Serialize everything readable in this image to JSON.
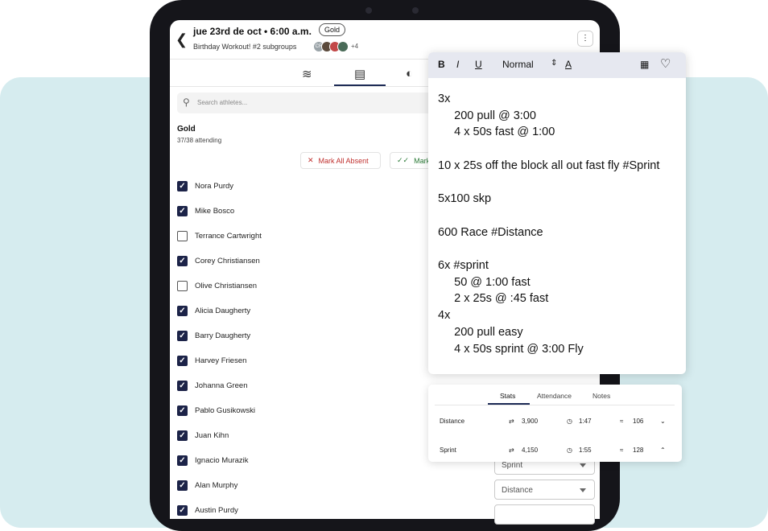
{
  "header": {
    "title": "jue 23rd de oct • 6:00 a.m.",
    "group_badge": "Gold",
    "subtitle": "Birthday Workout!  #2 subgroups",
    "avatar_more": "+4",
    "avatar_initials": "CR"
  },
  "search": {
    "placeholder": "Search athletes..."
  },
  "group": {
    "name": "Gold",
    "attendance": "37/38 attending"
  },
  "actions": {
    "mark_absent": "Mark All Absent",
    "mark_present": "Mark"
  },
  "athletes": [
    {
      "name": "Nora Purdy",
      "present": true
    },
    {
      "name": "Mike Bosco",
      "present": true
    },
    {
      "name": "Terrance Cartwright",
      "present": false
    },
    {
      "name": "Corey Christiansen",
      "present": true
    },
    {
      "name": "Olive Christiansen",
      "present": false
    },
    {
      "name": "Alicia Daugherty",
      "present": true
    },
    {
      "name": "Barry Daugherty",
      "present": true
    },
    {
      "name": "Harvey Friesen",
      "present": true
    },
    {
      "name": "Johanna Green",
      "present": true
    },
    {
      "name": "Pablo Gusikowski",
      "present": true
    },
    {
      "name": "Juan Kihn",
      "present": true
    },
    {
      "name": "Ignacio Murazik",
      "present": true
    },
    {
      "name": "Alan Murphy",
      "present": true
    },
    {
      "name": "Austin Purdy",
      "present": true
    }
  ],
  "selects": {
    "s1": "Sprint",
    "s2": "Distance"
  },
  "editor": {
    "toolbar": {
      "bold": "B",
      "italic": "I",
      "underline": "U",
      "style": "Normal"
    },
    "text": "3x\n     200 pull @ 3:00\n     4 x 50s fast @ 1:00\n\n10 x 25s off the block all out fast fly #Sprint\n\n5x100 skp\n\n600 Race #Distance\n\n6x #sprint\n     50 @ 1:00 fast\n     2 x 25s @ :45 fast\n4x\n     200 pull easy\n     4 x 50s sprint @ 3:00 Fly"
  },
  "stats_panel": {
    "tabs": [
      "Stats",
      "Attendance",
      "Notes"
    ],
    "rows": [
      {
        "label": "Distance",
        "yards": "3,900",
        "time": "1:47",
        "signal": "106"
      },
      {
        "label": "Sprint",
        "yards": "4,150",
        "time": "1:55",
        "signal": "128"
      }
    ]
  }
}
